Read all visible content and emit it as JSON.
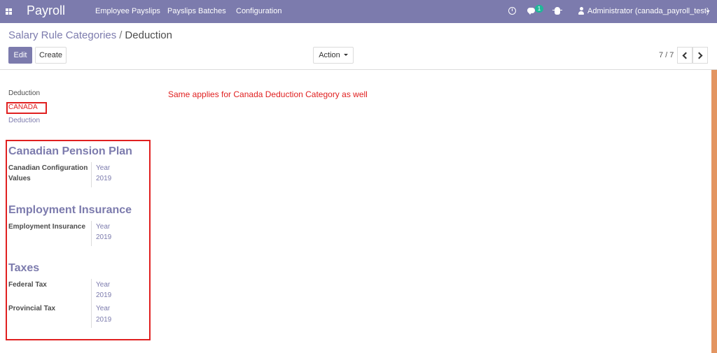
{
  "navbar": {
    "brand": "Payroll",
    "menu": [
      "Employee Payslips",
      "Payslips Batches",
      "Configuration"
    ],
    "notification_count": "1",
    "user_label": "Administrator (canada_payroll_test)"
  },
  "control_panel": {
    "breadcrumb_parent": "Salary Rule Categories",
    "breadcrumb_separator": "/",
    "breadcrumb_current": "Deduction",
    "edit_label": "Edit",
    "create_label": "Create",
    "action_label": "Action",
    "pager_value": "7 / 7"
  },
  "form": {
    "name": "Deduction",
    "country": "CANADA",
    "parent": "Deduction",
    "annotation": "Same applies for Canada Deduction Category as well",
    "sections": [
      {
        "title": "Canadian Pension Plan",
        "rows": [
          {
            "label": "Canadian Configuration Values",
            "value": [
              "Year",
              "2019"
            ]
          }
        ]
      },
      {
        "title": "Employment Insurance",
        "rows": [
          {
            "label": "Employment Insurance",
            "value": [
              "Year",
              "2019"
            ]
          }
        ]
      },
      {
        "title": "Taxes",
        "rows": [
          {
            "label": "Federal Tax",
            "value": [
              "Year",
              "2019"
            ]
          },
          {
            "label": "Provincial Tax",
            "value": [
              "Year",
              "2019"
            ]
          }
        ]
      }
    ]
  },
  "colors": {
    "brand": "#7c7bad",
    "annotation_red": "#e02020",
    "badge": "#21b799",
    "scrollbar": "#e39561"
  }
}
